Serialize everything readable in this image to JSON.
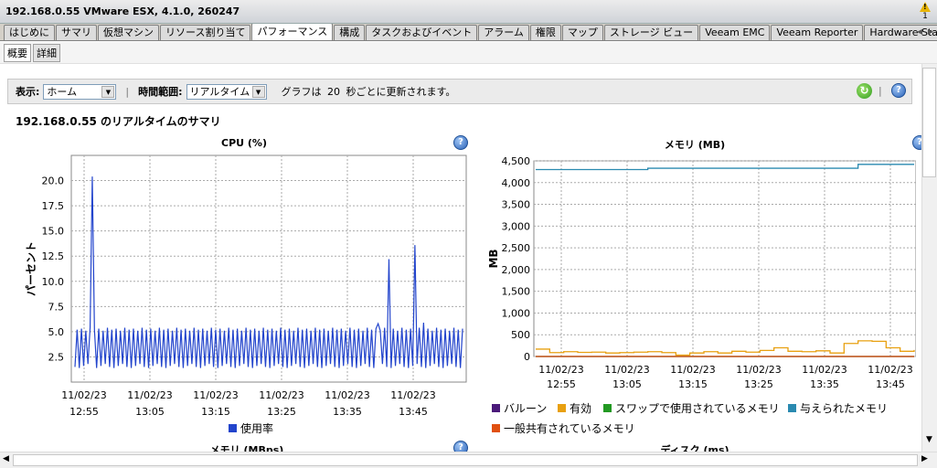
{
  "window": {
    "title": "192.168.0.55 VMware ESX, 4.1.0, 260247",
    "alert_count": "1"
  },
  "tabs": [
    {
      "label": "はじめに",
      "active": false
    },
    {
      "label": "サマリ",
      "active": false
    },
    {
      "label": "仮想マシン",
      "active": false
    },
    {
      "label": "リソース割り当て",
      "active": false
    },
    {
      "label": "パフォーマンス",
      "active": true
    },
    {
      "label": "構成",
      "active": false
    },
    {
      "label": "タスクおよびイベント",
      "active": false
    },
    {
      "label": "アラーム",
      "active": false
    },
    {
      "label": "権限",
      "active": false
    },
    {
      "label": "マップ",
      "active": false
    },
    {
      "label": "ストレージ ビュー",
      "active": false
    },
    {
      "label": "Veeam EMC",
      "active": false
    },
    {
      "label": "Veeam Reporter",
      "active": false
    },
    {
      "label": "Hardware Status",
      "active": false
    }
  ],
  "subtabs": [
    {
      "label": "概要",
      "active": true
    },
    {
      "label": "詳細",
      "active": false
    }
  ],
  "toolbar": {
    "view_label": "表示:",
    "view_value": "ホーム",
    "range_label": "時間範囲:",
    "range_value": "リアルタイム",
    "refresh_text_prefix": "グラフは",
    "refresh_interval": "20",
    "refresh_text_suffix": "秒ごとに更新されます。"
  },
  "page_title": "192.168.0.55 のリアルタイムのサマリ",
  "colors": {
    "cpu": "#2244cc",
    "memory_granted": "#2a8ab0",
    "active": "#e8a010",
    "balloon": "#4b1a7a",
    "swap": "#229922",
    "shared": "#e05010"
  },
  "chart_data": [
    {
      "type": "line",
      "title": "CPU (%)",
      "ylabel": "パーセント",
      "ylim": [
        0,
        22.5
      ],
      "yticks": [
        "2.5",
        "5.0",
        "7.5",
        "10.0",
        "12.5",
        "15.0",
        "17.5",
        "20.0"
      ],
      "xticks": [
        [
          "11/02/23",
          "12:55"
        ],
        [
          "11/02/23",
          "13:05"
        ],
        [
          "11/02/23",
          "13:15"
        ],
        [
          "11/02/23",
          "13:25"
        ],
        [
          "11/02/23",
          "13:35"
        ],
        [
          "11/02/23",
          "13:45"
        ]
      ],
      "series": [
        {
          "name": "使用率",
          "color": "#2244cc",
          "pattern": [
            1.5,
            5.2,
            1.4,
            5.3,
            1.6,
            5.1,
            1.8,
            5.4
          ],
          "spikes": [
            [
              0.043,
              20.4
            ],
            [
              0.81,
              12.2
            ],
            [
              0.875,
              13.6
            ],
            [
              0.78,
              5.8
            ],
            [
              0.9,
              5.9
            ]
          ]
        }
      ]
    },
    {
      "type": "line",
      "title": "メモリ (MB)",
      "ylabel": "MB",
      "ylim": [
        0,
        4500
      ],
      "yticks": [
        "0",
        "500",
        "1,000",
        "1,500",
        "2,000",
        "2,500",
        "3,000",
        "3,500",
        "4,000",
        "4,500"
      ],
      "xticks": [
        [
          "11/02/23",
          "12:55"
        ],
        [
          "11/02/23",
          "13:05"
        ],
        [
          "11/02/23",
          "13:15"
        ],
        [
          "11/02/23",
          "13:25"
        ],
        [
          "11/02/23",
          "13:35"
        ],
        [
          "11/02/23",
          "13:45"
        ]
      ],
      "series": [
        {
          "name": "バルーン",
          "color": "#4b1a7a",
          "values": [
            0,
            0,
            0,
            0,
            0,
            0,
            0,
            0,
            0,
            0,
            0,
            0,
            0,
            0,
            0,
            0,
            0,
            0,
            0,
            0,
            0,
            0,
            0,
            0,
            0,
            0,
            0,
            0
          ]
        },
        {
          "name": "有効",
          "color": "#e8a010",
          "values": [
            170,
            90,
            110,
            95,
            100,
            80,
            90,
            100,
            110,
            90,
            30,
            80,
            110,
            80,
            120,
            100,
            140,
            200,
            120,
            110,
            130,
            80,
            300,
            360,
            350,
            200,
            120,
            150
          ]
        },
        {
          "name": "スワップで使用されているメモリ",
          "color": "#229922",
          "values": [
            0,
            0,
            0,
            0,
            0,
            0,
            0,
            0,
            0,
            0,
            0,
            0,
            0,
            0,
            0,
            0,
            0,
            0,
            0,
            0,
            0,
            0,
            0,
            0,
            0,
            0,
            0,
            0
          ]
        },
        {
          "name": "与えられたメモリ",
          "color": "#2a8ab0",
          "values": [
            4300,
            4300,
            4300,
            4300,
            4300,
            4300,
            4300,
            4300,
            4330,
            4330,
            4330,
            4330,
            4330,
            4330,
            4330,
            4330,
            4330,
            4330,
            4330,
            4330,
            4330,
            4330,
            4330,
            4420,
            4420,
            4420,
            4420,
            4420
          ]
        },
        {
          "name": "一般共有されているメモリ",
          "color": "#e05010",
          "values": [
            0,
            0,
            0,
            0,
            0,
            0,
            0,
            0,
            0,
            0,
            0,
            0,
            0,
            0,
            0,
            0,
            0,
            0,
            0,
            0,
            0,
            0,
            0,
            0,
            0,
            0,
            0,
            0
          ]
        }
      ]
    }
  ],
  "bottom_titles": {
    "left": "メモリ (MBps)",
    "right": "ディスク (ms)"
  }
}
